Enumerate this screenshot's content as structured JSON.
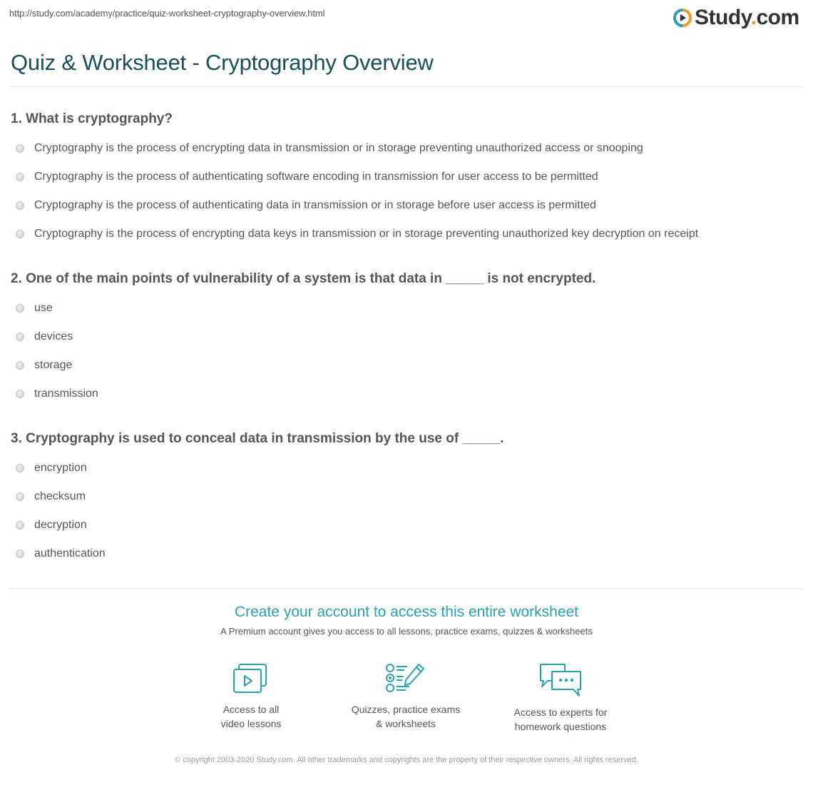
{
  "header": {
    "url": "http://study.com/academy/practice/quiz-worksheet-cryptography-overview.html",
    "logo_text": "Study",
    "logo_suffix": ".com",
    "logo_icon": "play-circle-icon",
    "brand_colors": {
      "primary": "#1b4e5c",
      "accent": "#2aa0b3",
      "orange": "#f29c1f"
    }
  },
  "page": {
    "title": "Quiz & Worksheet - Cryptography Overview"
  },
  "questions": [
    {
      "text": "1. What is cryptography?",
      "options": [
        "Cryptography is the process of encrypting data in transmission or in storage preventing unauthorized access or snooping",
        "Cryptography is the process of authenticating software encoding in transmission for user access to be permitted",
        "Cryptography is the process of authenticating data in transmission or in storage before user access is permitted",
        "Cryptography is the process of encrypting data keys in transmission or in storage preventing unauthorized key decryption on receipt"
      ]
    },
    {
      "text": "2. One of the main points of vulnerability of a system is that data in _____ is not encrypted.",
      "options": [
        "use",
        "devices",
        "storage",
        "transmission"
      ]
    },
    {
      "text": "3. Cryptography is used to conceal data in transmission by the use of _____.",
      "options": [
        "encryption",
        "checksum",
        "decryption",
        "authentication"
      ]
    }
  ],
  "cta": {
    "title": "Create your account to access this entire worksheet",
    "subtitle": "A Premium account gives you access to all lessons, practice exams, quizzes & worksheets",
    "features": [
      {
        "icon": "video-lessons-icon",
        "line1": "Access to all",
        "line2": "video lessons"
      },
      {
        "icon": "quiz-checklist-icon",
        "line1": "Quizzes, practice exams",
        "line2": "& worksheets"
      },
      {
        "icon": "chat-bubbles-icon",
        "line1": "Access to experts for",
        "line2": "homework questions"
      }
    ]
  },
  "footer": {
    "copyright": "© copyright 2003-2020 Study.com. All other trademarks and copyrights are the property of their respective owners. All rights reserved."
  }
}
